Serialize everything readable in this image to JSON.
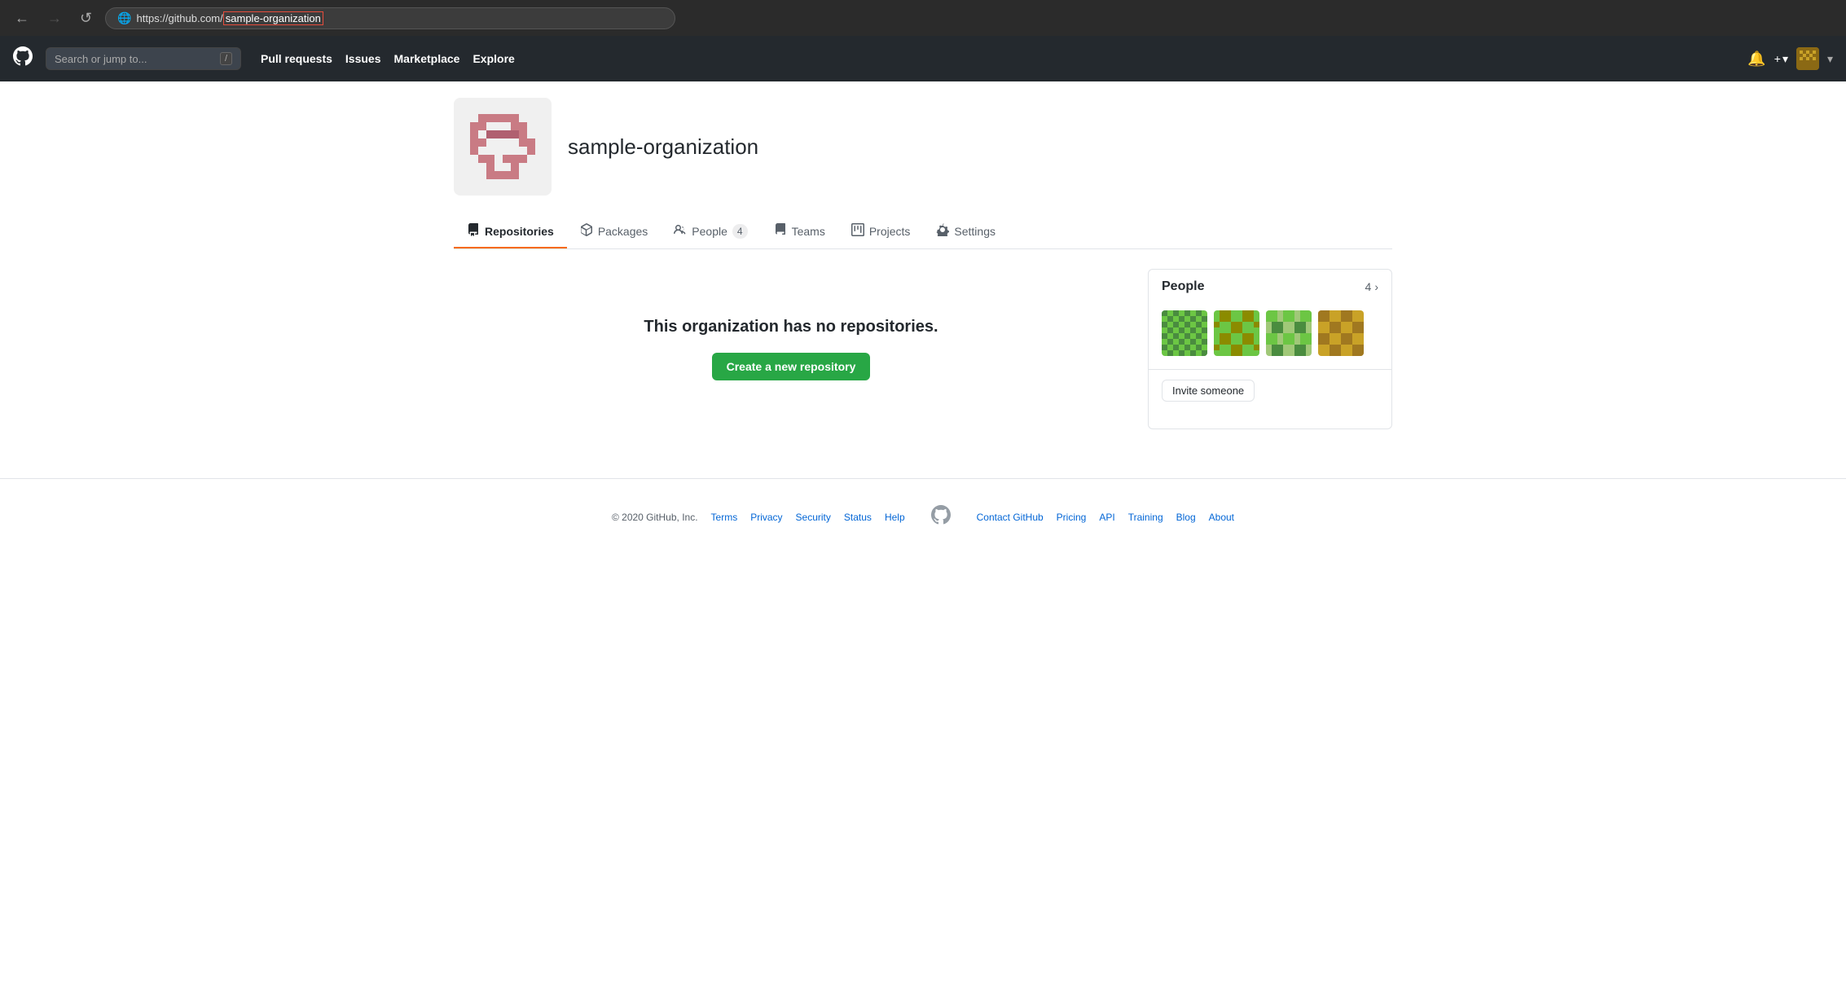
{
  "browser": {
    "back_btn": "←",
    "forward_btn": "→",
    "reload_btn": "↺",
    "url_prefix": "https://github.com/",
    "url_highlight": "sample-organization"
  },
  "navbar": {
    "logo": "🐙",
    "search_placeholder": "Search or jump to...",
    "search_kbd": "/",
    "links": [
      {
        "label": "Pull requests"
      },
      {
        "label": "Issues"
      },
      {
        "label": "Marketplace"
      },
      {
        "label": "Explore"
      }
    ],
    "bell_icon": "🔔",
    "plus_label": "+",
    "chevron_down": "▾"
  },
  "org": {
    "name": "sample-organization"
  },
  "tabs": [
    {
      "id": "repositories",
      "icon": "repo",
      "label": "Repositories",
      "active": true
    },
    {
      "id": "packages",
      "icon": "package",
      "label": "Packages",
      "active": false
    },
    {
      "id": "people",
      "icon": "people",
      "label": "People",
      "count": "4",
      "active": false
    },
    {
      "id": "teams",
      "icon": "teams",
      "label": "Teams",
      "active": false
    },
    {
      "id": "projects",
      "icon": "projects",
      "label": "Projects",
      "active": false
    },
    {
      "id": "settings",
      "icon": "settings",
      "label": "Settings",
      "active": false
    }
  ],
  "main": {
    "empty_message": "This organization has no repositories.",
    "create_repo_label": "Create a new repository"
  },
  "people_sidebar": {
    "title": "People",
    "count": "4",
    "chevron": "›",
    "invite_label": "Invite someone",
    "members": [
      {
        "id": "member-1",
        "color1": "#6cc644",
        "color2": "#4a7c3f"
      },
      {
        "id": "member-2",
        "color1": "#6cc644",
        "color2": "#8b8b00"
      },
      {
        "id": "member-3",
        "color1": "#6cc644",
        "color2": "#4a7c3f"
      },
      {
        "id": "member-4",
        "color1": "#c9a227",
        "color2": "#a0862e"
      }
    ]
  },
  "footer": {
    "copyright": "© 2020 GitHub, Inc.",
    "links": [
      {
        "label": "Terms"
      },
      {
        "label": "Privacy"
      },
      {
        "label": "Security"
      },
      {
        "label": "Status"
      },
      {
        "label": "Help"
      },
      {
        "label": "Contact GitHub"
      },
      {
        "label": "Pricing"
      },
      {
        "label": "API"
      },
      {
        "label": "Training"
      },
      {
        "label": "Blog"
      },
      {
        "label": "About"
      }
    ]
  }
}
